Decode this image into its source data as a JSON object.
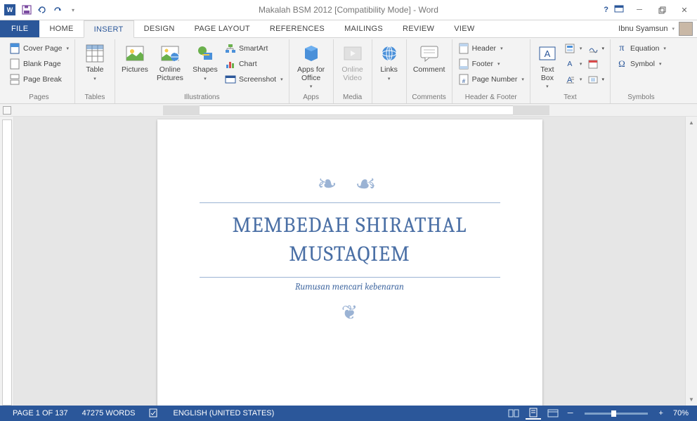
{
  "title": "Makalah BSM 2012 [Compatibility Mode] - Word",
  "user": "Ibnu Syamsun",
  "tabs": {
    "file": "FILE",
    "home": "HOME",
    "insert": "INSERT",
    "design": "DESIGN",
    "pagelayout": "PAGE LAYOUT",
    "references": "REFERENCES",
    "mailings": "MAILINGS",
    "review": "REVIEW",
    "view": "VIEW"
  },
  "groups": {
    "pages": {
      "label": "Pages",
      "cover": "Cover Page",
      "blank": "Blank Page",
      "break": "Page Break"
    },
    "tables": {
      "label": "Tables",
      "table": "Table"
    },
    "illustrations": {
      "label": "Illustrations",
      "pictures": "Pictures",
      "online": "Online Pictures",
      "shapes": "Shapes",
      "smartart": "SmartArt",
      "chart": "Chart",
      "screenshot": "Screenshot"
    },
    "apps": {
      "label": "Apps",
      "apps": "Apps for Office"
    },
    "media": {
      "label": "Media",
      "video": "Online Video"
    },
    "links": {
      "label": "",
      "links": "Links"
    },
    "comments": {
      "label": "Comments",
      "comment": "Comment"
    },
    "headerfooter": {
      "label": "Header & Footer",
      "header": "Header",
      "footer": "Footer",
      "pagenum": "Page Number"
    },
    "text": {
      "label": "Text",
      "textbox": "Text Box"
    },
    "symbols": {
      "label": "Symbols",
      "equation": "Equation",
      "symbol": "Symbol"
    }
  },
  "document": {
    "title": "MEMBEDAH SHIRATHAL MUSTAQIEM",
    "subtitle": "Rumusan mencari kebenaran"
  },
  "status": {
    "page": "PAGE 1 OF 137",
    "words": "47275 WORDS",
    "lang": "ENGLISH (UNITED STATES)",
    "zoom": "70%"
  }
}
